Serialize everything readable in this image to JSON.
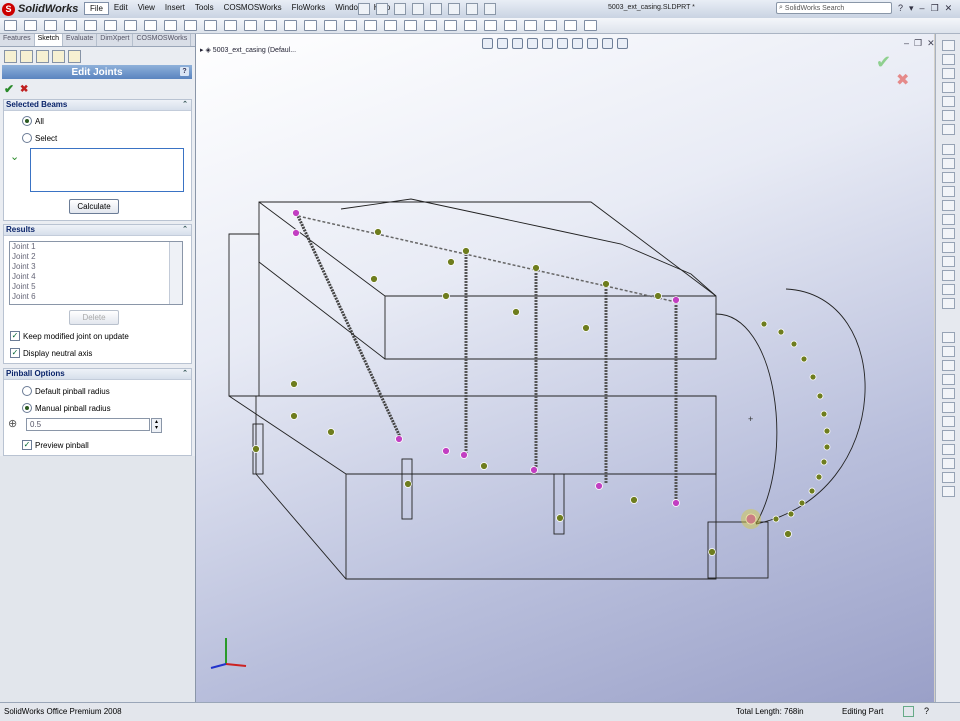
{
  "app": {
    "name": "SolidWorks",
    "logo_letter": "S"
  },
  "menu": [
    "File",
    "Edit",
    "View",
    "Insert",
    "Tools",
    "COSMOSWorks",
    "FloWorks",
    "Window",
    "Help"
  ],
  "document_title": "5003_ext_casing.SLDPRT *",
  "search": {
    "placeholder": "SolidWorks Search"
  },
  "tabs": [
    "Features",
    "Sketch",
    "Evaluate",
    "DimXpert",
    "COSMOSWorks"
  ],
  "property_manager": {
    "title": "Edit Joints",
    "help": "?",
    "ok": "✔",
    "cancel": "✖",
    "selected_beams": {
      "header": "Selected Beams",
      "options": [
        "All",
        "Select"
      ],
      "selected": "All",
      "calculate": "Calculate"
    },
    "results": {
      "header": "Results",
      "joints": [
        "Joint 1",
        "Joint 2",
        "Joint 3",
        "Joint 4",
        "Joint 5",
        "Joint 6"
      ],
      "delete": "Delete",
      "keep_modified": "Keep modified joint on update",
      "display_neutral": "Display neutral axis"
    },
    "pinball": {
      "header": "Pinball Options",
      "options": [
        "Default pinball radius",
        "Manual pinball radius"
      ],
      "selected": "Manual pinball radius",
      "radius": "0.5",
      "preview": "Preview pinball"
    }
  },
  "viewport": {
    "tree_item": "5003_ext_casing  (Defaul..."
  },
  "status": {
    "left": "SolidWorks Office Premium 2008",
    "total_length": "Total Length: 768in",
    "mode": "Editing Part"
  },
  "colors": {
    "accent": "#5a84bf",
    "joint_green": "#6e7d1e",
    "joint_pink": "#c23fc2"
  }
}
